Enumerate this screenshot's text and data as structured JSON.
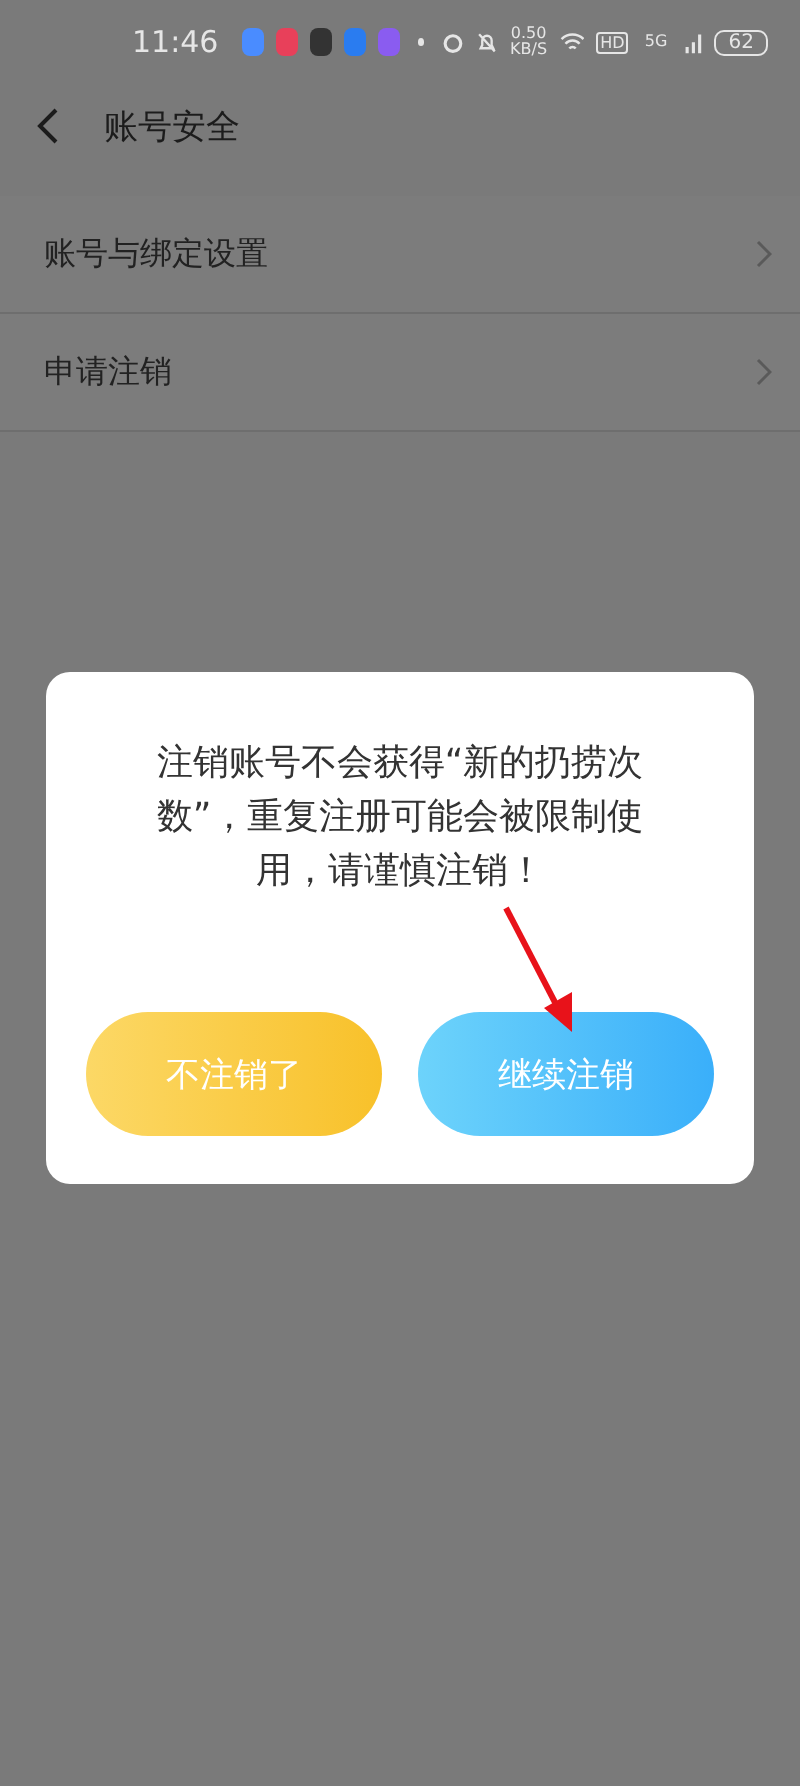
{
  "status_bar": {
    "time": "11:46",
    "speed": "0.50 KB/S",
    "hd": "HD",
    "network": "5G",
    "battery": "62"
  },
  "header": {
    "title": "账号安全"
  },
  "menu": [
    {
      "label": "账号与绑定设置"
    },
    {
      "label": "申请注销"
    }
  ],
  "dialog": {
    "message": "注销账号不会获得“新的扔捞次数”，重复注册可能会被限制使用，请谨慎注销！",
    "buttons": [
      {
        "label": "不注销了",
        "kind": "cancel"
      },
      {
        "label": "继续注销",
        "kind": "confirm"
      }
    ]
  }
}
